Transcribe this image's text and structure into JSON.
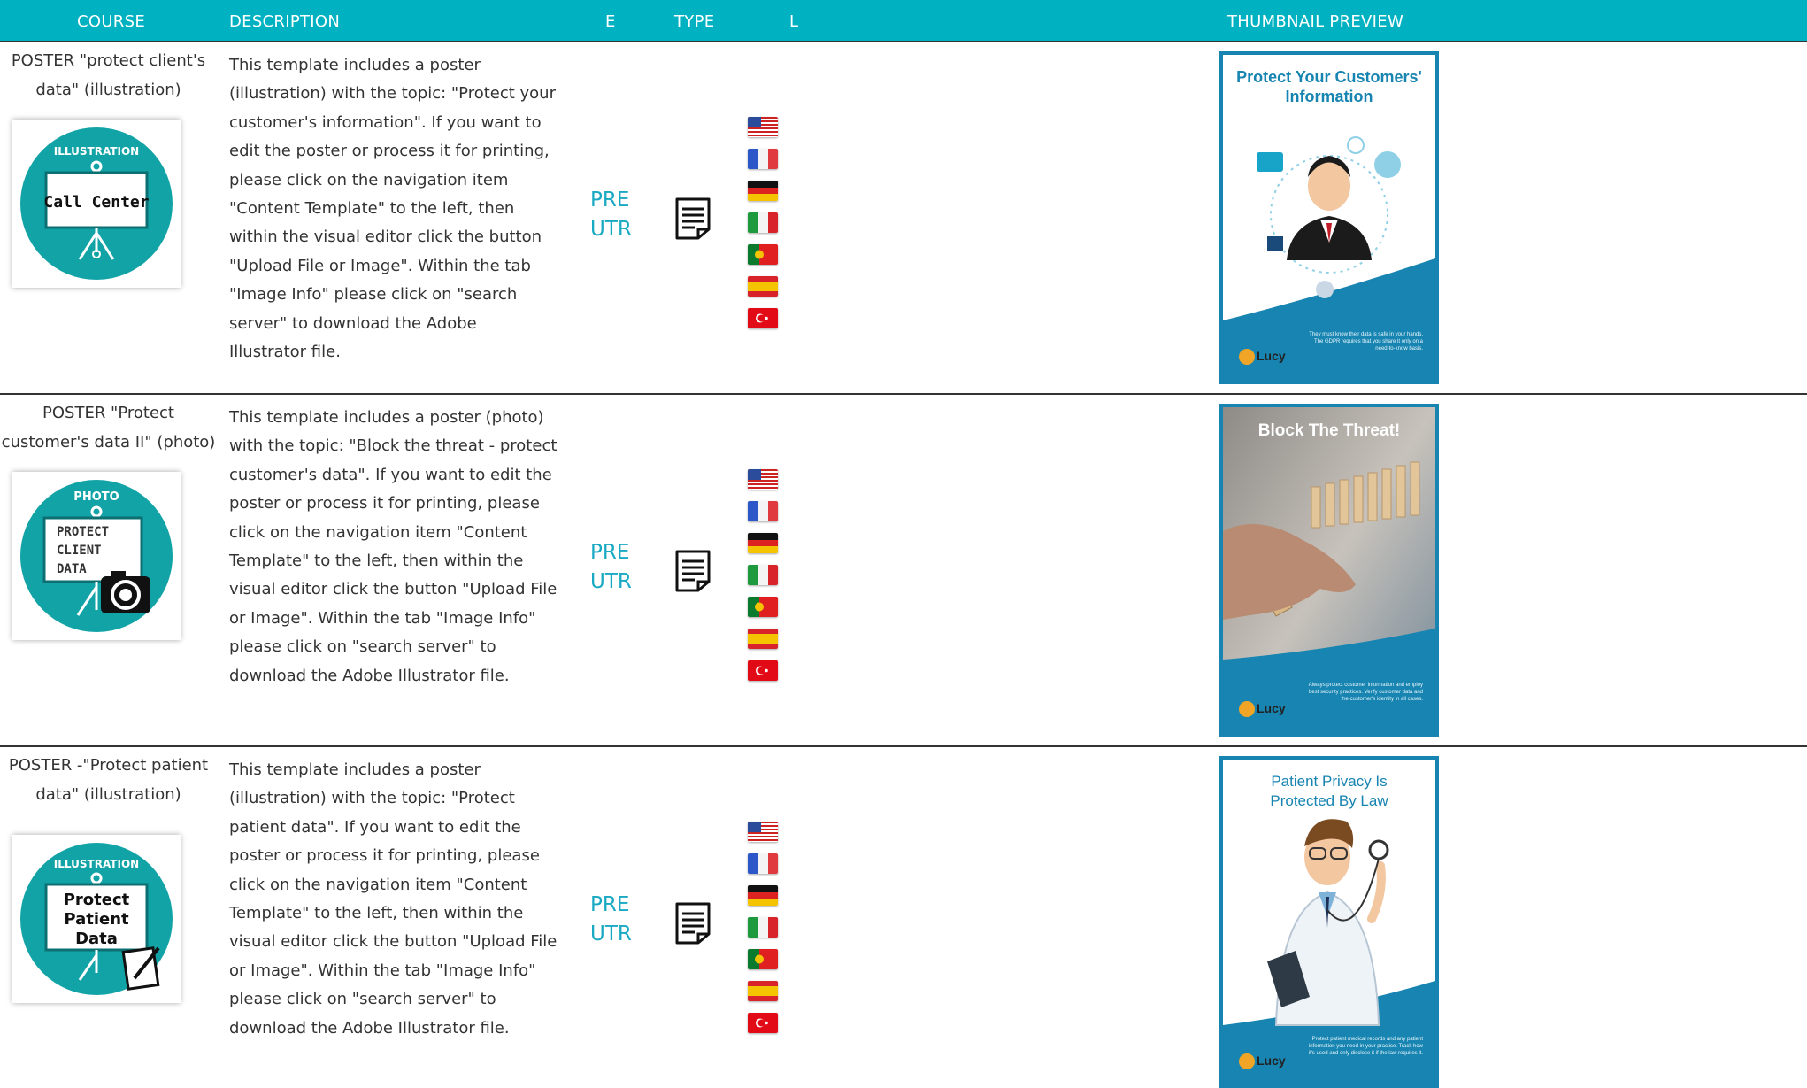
{
  "header": {
    "columns": {
      "course": "COURSE",
      "description": "DESCRIPTION",
      "e": "E",
      "type": "TYPE",
      "l": "L",
      "thumbnail": "THUMBNAIL PREVIEW"
    }
  },
  "colors": {
    "header_bg": "#00b2c1",
    "accent_text": "#19a9c3",
    "poster_blue": "#1784b1"
  },
  "type_icon": "document-icon",
  "languages": [
    "us-flag",
    "fr-flag",
    "de-flag",
    "it-flag",
    "pt-flag",
    "es-flag",
    "tr-flag"
  ],
  "rows": [
    {
      "course": "POSTER \"protect client's data\" (illustration)",
      "icon_label_top": "ILLUSTRATION",
      "icon_label_main": "Call Center",
      "description": "This template includes a poster (illustration) with the topic: \"Protect your customer's information\". If you want to edit the poster or process it for printing, please click on the navigation item \"Content Template\" to the left, then within the visual editor click the button \"Upload File or Image\". Within the tab \"Image Info\" please click on \"search server\" to download the Adobe Illustrator file.",
      "exec_1": "PRE",
      "exec_2": "UTR",
      "thumb_title": "Protect Your Customers' Information",
      "thumb_caption": "They must know their data is safe in your hands. The GDPR requires that you share it only on a need-to-know basis.",
      "brand": "Lucy"
    },
    {
      "course": "POSTER \"Protect customer's data II\" (photo)",
      "icon_label_top": "PHOTO",
      "icon_label_main": "PROTECT CLIENT DATA",
      "description": "This template includes a poster (photo) with the topic: \"Block the threat - protect customer's data\". If you want to edit the poster or process it for printing, please click on the navigation item \"Content Template\" to the left, then within the visual editor click the button \"Upload File or Image\". Within the tab \"Image Info\" please click on \"search server\" to download the Adobe Illustrator file.",
      "exec_1": "PRE",
      "exec_2": "UTR",
      "thumb_title": "Block The Threat!",
      "thumb_caption": "Always protect customer information and employ best security practices. Verify customer data and the customer's identity in all cases.",
      "brand": "Lucy"
    },
    {
      "course": "POSTER -\"Protect patient data\" (illustration)",
      "icon_label_top": "ILLUSTRATION",
      "icon_label_main": "Protect Patient Data",
      "description": "This template includes a poster (illustration) with the topic: \"Protect patient data\". If you want to edit the poster or process it for printing, please click on the navigation item \"Content Template\" to the left, then within the visual editor click the button \"Upload File or Image\". Within the tab \"Image Info\" please click on \"search server\" to download the Adobe Illustrator file.",
      "exec_1": "PRE",
      "exec_2": "UTR",
      "thumb_title": "Patient Privacy Is Protected By Law",
      "thumb_caption": "Protect patient medical records and any patient information you need in your practice. Track how it's used and only disclose it if the law requires it.",
      "brand": "Lucy"
    }
  ]
}
